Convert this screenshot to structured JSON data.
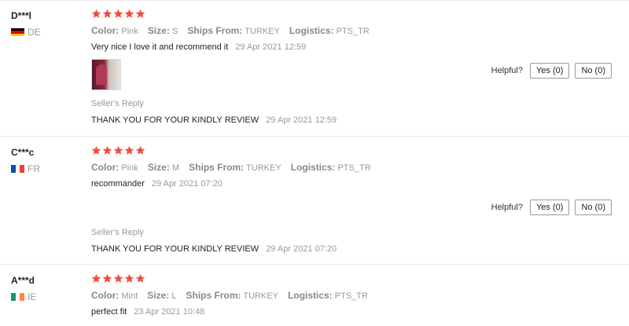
{
  "reviews": [
    {
      "user": "D***l",
      "country": "DE",
      "flag_colors": [
        "#000000",
        "#dd0000",
        "#ffce00"
      ],
      "attributes": [
        {
          "key": "Color:",
          "value": "Pink"
        },
        {
          "key": "Size:",
          "value": "S"
        },
        {
          "key": "Ships From:",
          "value": "TURKEY"
        },
        {
          "key": "Logistics:",
          "value": "PTS_TR"
        }
      ],
      "text": "Very nice I love it and recommend it",
      "time": "29 Apr 2021 12:59",
      "reply_label": "Seller's Reply",
      "reply_text": "THANK YOU FOR YOUR KINDLY REVIEW",
      "reply_time": "29 Apr 2021 12:59",
      "helpful_label": "Helpful?",
      "yes_label": "Yes (0)",
      "no_label": "No (0)",
      "rating": 5,
      "has_photo": true
    },
    {
      "user": "C***c",
      "country": "FR",
      "flag_colors": [
        "#0055a4",
        "#ffffff",
        "#ef4135"
      ],
      "attributes": [
        {
          "key": "Color:",
          "value": "Pink"
        },
        {
          "key": "Size:",
          "value": "M"
        },
        {
          "key": "Ships From:",
          "value": "TURKEY"
        },
        {
          "key": "Logistics:",
          "value": "PTS_TR"
        }
      ],
      "text": "recommander",
      "time": "29 Apr 2021 07:20",
      "reply_label": "Seller's Reply",
      "reply_text": "THANK YOU FOR YOUR KINDLY REVIEW",
      "reply_time": "29 Apr 2021 07:20",
      "helpful_label": "Helpful?",
      "yes_label": "Yes (0)",
      "no_label": "No (0)",
      "rating": 5,
      "has_photo": false
    },
    {
      "user": "A***d",
      "country": "IE",
      "flag_colors": [
        "#169b62",
        "#ffffff",
        "#ff883e"
      ],
      "attributes": [
        {
          "key": "Color:",
          "value": "Mint"
        },
        {
          "key": "Size:",
          "value": "L"
        },
        {
          "key": "Ships From:",
          "value": "TURKEY"
        },
        {
          "key": "Logistics:",
          "value": "PTS_TR"
        }
      ],
      "text": "perfect fit",
      "time": "23 Apr 2021 10:48",
      "rating": 5,
      "has_photo": false
    }
  ],
  "colors": {
    "star": "#f24d3f",
    "muted_text": "#999999",
    "divider": "#e8e8e8"
  },
  "icons": {
    "star": "star-icon",
    "flag": "flag-icon"
  }
}
